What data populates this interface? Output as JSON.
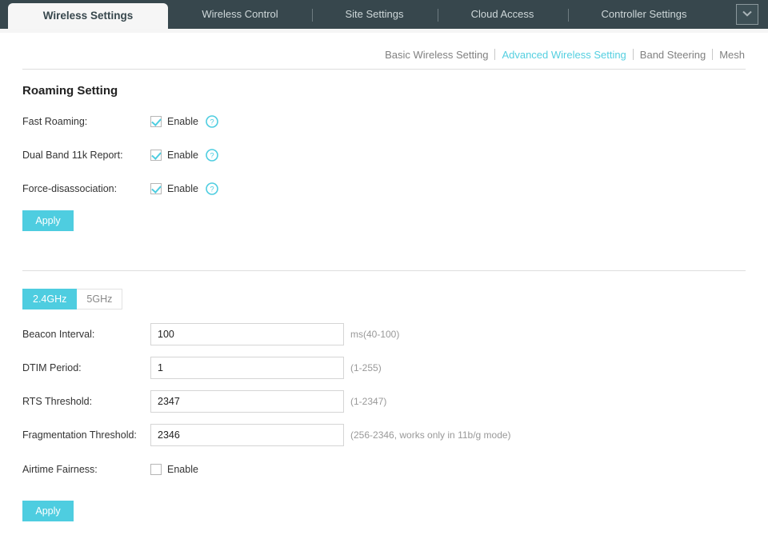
{
  "tabbar": {
    "tabs": [
      {
        "label": "Wireless Settings",
        "active": true
      },
      {
        "label": "Wireless Control",
        "active": false
      },
      {
        "label": "Site Settings",
        "active": false
      },
      {
        "label": "Cloud Access",
        "active": false
      },
      {
        "label": "Controller Settings",
        "active": false
      }
    ],
    "dropdown_icon": "chevron-down-icon",
    "background_color": "#37474d",
    "active_tab_background": "#f6f6f6"
  },
  "subnav": {
    "links": [
      {
        "label": "Basic Wireless Setting",
        "active": false
      },
      {
        "label": "Advanced Wireless Setting",
        "active": true
      },
      {
        "label": "Band Steering",
        "active": false
      },
      {
        "label": "Mesh",
        "active": false
      }
    ],
    "active_color": "#54cfe0",
    "inactive_color": "#808080"
  },
  "roaming": {
    "title": "Roaming Setting",
    "rows": [
      {
        "label": "Fast Roaming:",
        "checkbox_label": "Enable",
        "checked": true,
        "help": "help-icon"
      },
      {
        "label": "Dual Band 11k Report:",
        "checkbox_label": "Enable",
        "checked": true,
        "help": "help-icon"
      },
      {
        "label": "Force-disassociation:",
        "checkbox_label": "Enable",
        "checked": true,
        "help": "help-icon"
      }
    ],
    "apply_label": "Apply"
  },
  "band_section": {
    "bands": [
      {
        "label": "2.4GHz",
        "active": true
      },
      {
        "label": "5GHz",
        "active": false
      }
    ],
    "fields": [
      {
        "label": "Beacon Interval:",
        "value": "100",
        "placeholder": "",
        "hint": "ms(40-100)"
      },
      {
        "label": "DTIM Period:",
        "value": "1",
        "placeholder": "",
        "hint": "(1-255)"
      },
      {
        "label": "RTS Threshold:",
        "value": "2347",
        "placeholder": "",
        "hint": "(1-2347)"
      },
      {
        "label": "Fragmentation Threshold:",
        "value": "2346",
        "placeholder": "",
        "hint": "(256-2346, works only in 11b/g mode)"
      }
    ],
    "airtime": {
      "label": "Airtime Fairness:",
      "checkbox_label": "Enable",
      "checked": false
    },
    "apply_label": "Apply"
  },
  "theme": {
    "accent": "#4ecde0",
    "header_dark": "#37474d",
    "divider": "#dedede",
    "text": "#333333",
    "hint": "#999999"
  }
}
